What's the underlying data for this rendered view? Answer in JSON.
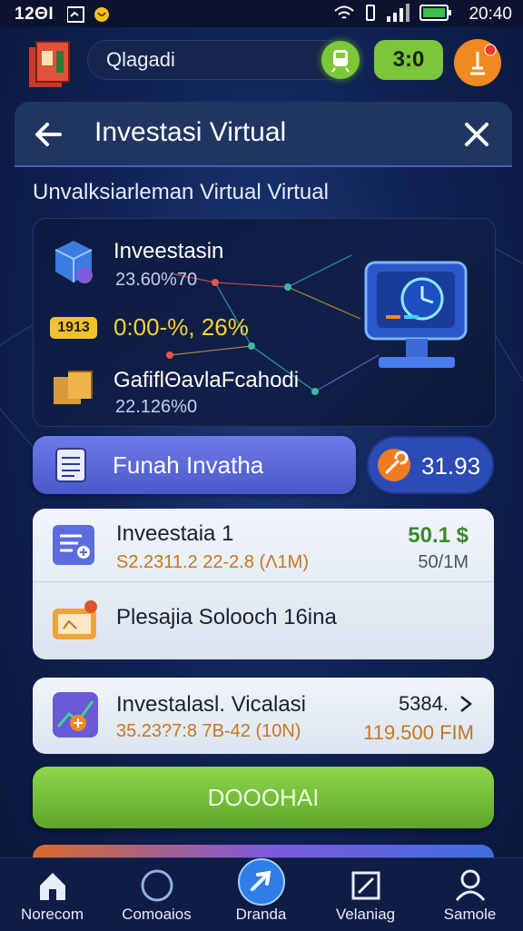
{
  "status_bar": {
    "time_left": "12ΘΙ",
    "time_right": "20:40"
  },
  "app_header": {
    "search_value": "Qlagadi",
    "score": "3:0"
  },
  "dialog": {
    "title": "Investasi Virtual"
  },
  "subtitle": "Unvalksiarleman Virtual Virtual",
  "stats": {
    "item1_title": "Inveestasin",
    "item1_sub": "23.60%70",
    "item2_badge": "1913",
    "item2_value": "0:00-%, 26%",
    "item3_title": "GafiflΘavlaFcahodi",
    "item3_sub": "22.126%0"
  },
  "actions": {
    "funds_label": "Funah Invatha",
    "coin_value": "31.93"
  },
  "card1": {
    "title": "Inveestaia 1",
    "sub": "S2.2311.2 22-2.8 (Λ1M)",
    "green_value": "50.1 $",
    "grey_value": "50/1M",
    "row2_title": "Plesajia Solooch 16ina"
  },
  "card2": {
    "title": "Investalasl. Vicalasi",
    "sub": "35.23?7:8 7B-42 (10N)",
    "amount": "5384.",
    "orange_value": "119.500 FIM"
  },
  "primary_button": "DOOOHAI",
  "bottom_nav": [
    {
      "label": "Norecom",
      "icon": "home-icon"
    },
    {
      "label": "Comoaios",
      "icon": "compass-icon"
    },
    {
      "label": "Dranda",
      "icon": "rocket-icon"
    },
    {
      "label": "Velaniag",
      "icon": "chart-icon"
    },
    {
      "label": "Samole",
      "icon": "profile-icon"
    }
  ],
  "colors": {
    "accent_green": "#7cc73a",
    "accent_orange": "#f08a1f",
    "accent_purple": "#5d69d8",
    "gold": "#f6d236"
  }
}
